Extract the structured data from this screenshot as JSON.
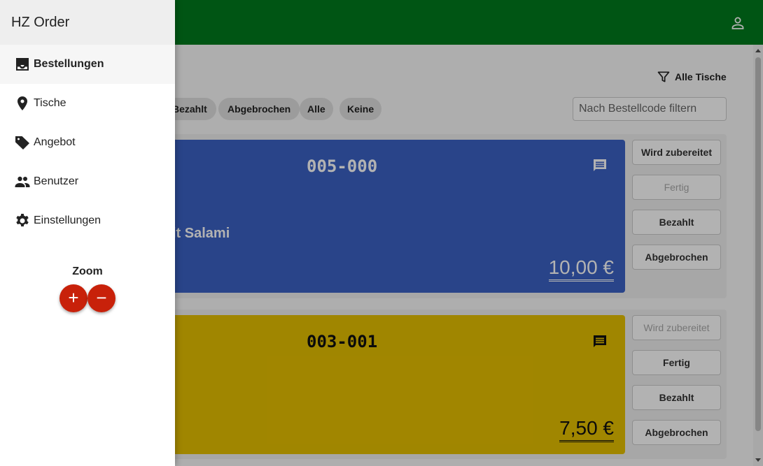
{
  "app": {
    "title": "HZ Order"
  },
  "nav": {
    "items": [
      {
        "label": "Bestellungen",
        "icon": "inbox-icon",
        "active": true
      },
      {
        "label": "Tische",
        "icon": "location-pin-icon"
      },
      {
        "label": "Angebot",
        "icon": "tag-icon"
      },
      {
        "label": "Benutzer",
        "icon": "people-icon"
      },
      {
        "label": "Einstellungen",
        "icon": "gear-icon"
      }
    ],
    "zoom_label": "Zoom",
    "zoom_in_symbol": "+",
    "zoom_out_symbol": "−"
  },
  "main": {
    "title_fragment": ")",
    "filter_label": "Alle Tische",
    "chips": [
      "Bezahlt",
      "Abgebrochen",
      "Alle",
      "Keine"
    ],
    "search_placeholder": "Nach Bestellcode filtern",
    "orders": [
      {
        "code": "005-000",
        "item": "it Salami",
        "price": "10,00 €",
        "card_color": "#3b62c4",
        "actions": [
          {
            "label": "Wird zubereitet",
            "disabled": false
          },
          {
            "label": "Fertig",
            "disabled": true
          },
          {
            "label": "Bezahlt",
            "disabled": false
          },
          {
            "label": "Abgebrochen",
            "disabled": false
          }
        ]
      },
      {
        "code": "003-001",
        "price": "7,50 €",
        "card_color": "#e6c000",
        "actions": [
          {
            "label": "Wird zubereitet",
            "disabled": true
          },
          {
            "label": "Fertig",
            "disabled": false
          },
          {
            "label": "Bezahlt",
            "disabled": false
          },
          {
            "label": "Abgebrochen",
            "disabled": false
          }
        ]
      }
    ]
  },
  "colors": {
    "topbar": "#007a1e",
    "zoom_button": "#c8210a"
  }
}
